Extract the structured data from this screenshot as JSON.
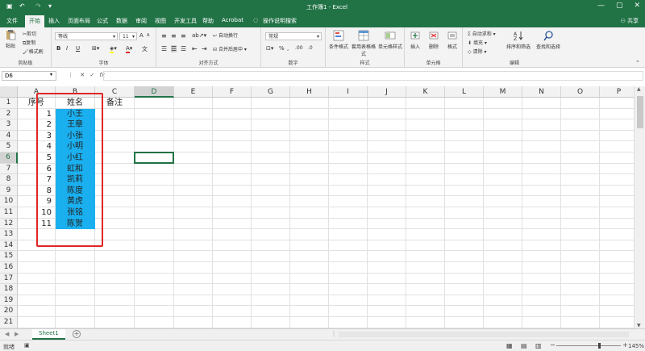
{
  "title": {
    "text": "工作簿1 - Excel",
    "window_controls": [
      "—",
      "▢",
      "✕"
    ],
    "share": "共享"
  },
  "tabs": [
    "文件",
    "开始",
    "插入",
    "页面布局",
    "公式",
    "数据",
    "审阅",
    "视图",
    "开发工具",
    "帮助",
    "Acrobat",
    "操作说明搜索"
  ],
  "ribbon": {
    "clipboard": {
      "paste": "粘贴",
      "cut": "剪切",
      "copy": "复制",
      "format_painter": "格式刷",
      "label": "剪贴板"
    },
    "font": {
      "font_name": "等线",
      "font_size": "11",
      "bold": "B",
      "italic": "I",
      "underline": "U",
      "label": "字体",
      "grow": "A",
      "shrink": "A",
      "phonetic": "文"
    },
    "alignment": {
      "wrap": "自动换行",
      "merge": "合并后居中",
      "label": "对齐方式"
    },
    "number": {
      "format": "常规",
      "percent": "%",
      "comma": ",",
      "inc_dec": ".00",
      "dec_dec": ".0",
      "label": "数字"
    },
    "styles": {
      "conditional": "条件格式",
      "table": "套用表格格式",
      "cell_styles": "单元格样式",
      "label": "样式"
    },
    "cells": {
      "insert": "插入",
      "delete": "删除",
      "format": "格式",
      "label": "单元格"
    },
    "editing": {
      "autosum": "自动求和",
      "fill": "填充",
      "clear": "清除",
      "sort": "排序和筛选",
      "find": "查找和选择",
      "label": "编辑"
    }
  },
  "formula_bar": {
    "name_box": "D6",
    "fx": "fx",
    "formula": ""
  },
  "columns": [
    "A",
    "B",
    "C",
    "D",
    "E",
    "F",
    "G",
    "H",
    "I",
    "J",
    "K",
    "L",
    "M",
    "N",
    "O",
    "P"
  ],
  "rows": [
    "1",
    "2",
    "3",
    "4",
    "5",
    "6",
    "7",
    "8",
    "9",
    "10",
    "11",
    "12",
    "13",
    "14",
    "15",
    "16",
    "17",
    "18",
    "19",
    "20",
    "21"
  ],
  "headers": {
    "A": "序号",
    "B": "姓名",
    "C": "备注"
  },
  "data_rows": [
    {
      "seq": "1",
      "name": "小王"
    },
    {
      "seq": "2",
      "name": "王章"
    },
    {
      "seq": "3",
      "name": "小张"
    },
    {
      "seq": "4",
      "name": "小明"
    },
    {
      "seq": "5",
      "name": "小红"
    },
    {
      "seq": "6",
      "name": "虹和"
    },
    {
      "seq": "7",
      "name": "凯莉"
    },
    {
      "seq": "8",
      "name": "陈度"
    },
    {
      "seq": "9",
      "name": "黄虎"
    },
    {
      "seq": "10",
      "name": "张铭"
    },
    {
      "seq": "11",
      "name": "陈贺"
    }
  ],
  "active_cell": "D6",
  "sheets": [
    "Sheet1"
  ],
  "status": {
    "text": "就绪",
    "zoom": "145%"
  },
  "colors": {
    "accent": "#217346",
    "highlight": "#1ab0f0",
    "annotation": "#e02626"
  }
}
